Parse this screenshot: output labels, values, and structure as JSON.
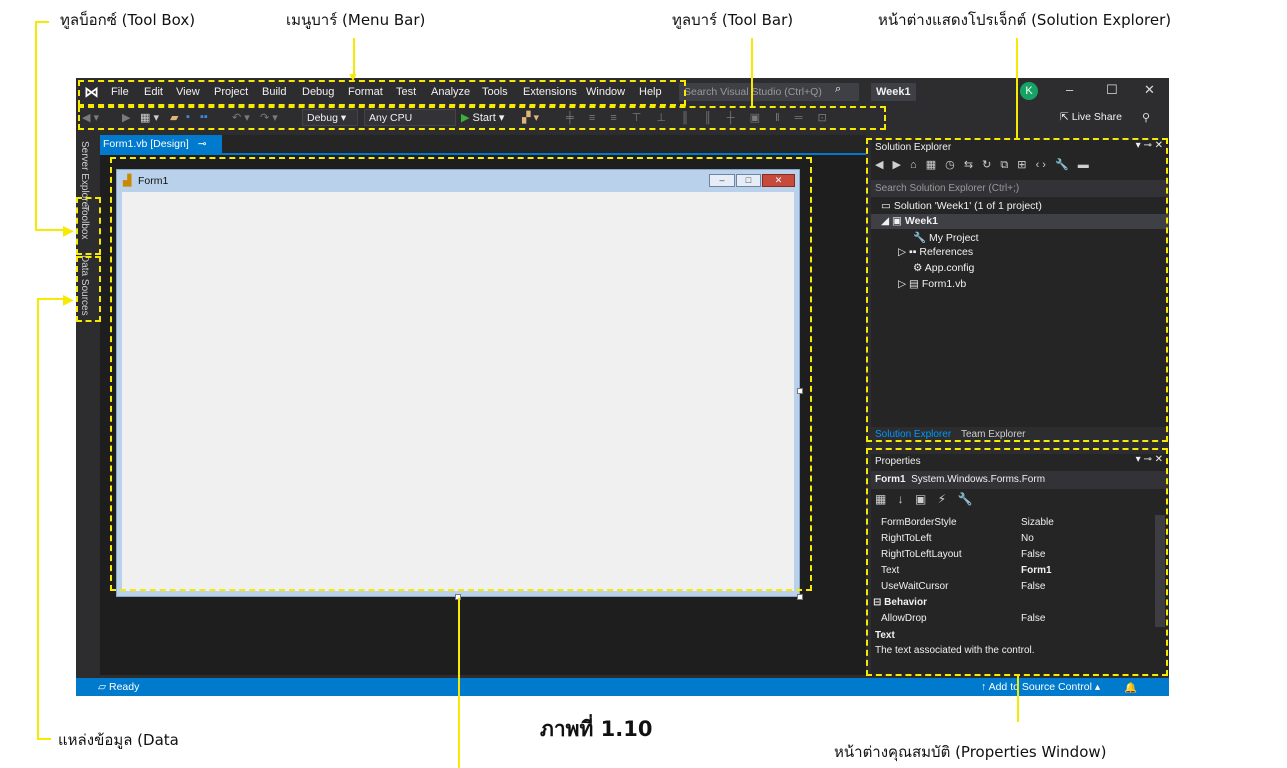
{
  "annotations": {
    "toolbox": "ทูลบ็อกซ์ (Tool Box)",
    "menubar": "เมนูบาร์ (Menu Bar)",
    "toolbar": "ทูลบาร์ (Tool Bar)",
    "solution_explorer": "หน้าต่างแสดงโปรเจ็กต์ (Solution Explorer)",
    "data_sources": "แหล่งข้อมูล (Data",
    "properties_window": "หน้าต่างคุณสมบัติ (Properties Window)",
    "figure_caption": "ภาพที่ 1.10"
  },
  "menu": {
    "items": [
      "File",
      "Edit",
      "View",
      "Project",
      "Build",
      "Debug",
      "Format",
      "Test",
      "Analyze",
      "Tools",
      "Extensions",
      "Window",
      "Help"
    ],
    "search_placeholder": "Search Visual Studio (Ctrl+Q)",
    "project_name": "Week1",
    "avatar": "K"
  },
  "toolbar": {
    "config": "Debug",
    "platform": "Any CPU",
    "start": "Start",
    "live_share": "Live Share"
  },
  "side_tabs": [
    "Server Explorer",
    "Toolbox",
    "Data Sources"
  ],
  "document": {
    "tab_title": "Form1.vb [Design]",
    "form_title": "Form1"
  },
  "solution_explorer": {
    "title": "Solution Explorer",
    "search_placeholder": "Search Solution Explorer (Ctrl+;)",
    "tree": {
      "solution": "Solution 'Week1' (1 of 1 project)",
      "project": "Week1",
      "my_project": "My Project",
      "references": "References",
      "app_config": "App.config",
      "form1": "Form1.vb"
    },
    "tabs": [
      "Solution Explorer",
      "Team Explorer"
    ]
  },
  "properties": {
    "title": "Properties",
    "object_name": "Form1",
    "object_type": "System.Windows.Forms.Form",
    "rows": [
      {
        "name": "FormBorderStyle",
        "value": "Sizable"
      },
      {
        "name": "RightToLeft",
        "value": "No"
      },
      {
        "name": "RightToLeftLayout",
        "value": "False"
      },
      {
        "name": "Text",
        "value": "Form1"
      },
      {
        "name": "UseWaitCursor",
        "value": "False"
      }
    ],
    "category": "Behavior",
    "row_after_category": {
      "name": "AllowDrop",
      "value": "False"
    },
    "desc_title": "Text",
    "desc_text": "The text associated with the control."
  },
  "status": {
    "ready": "Ready",
    "source_control": "Add to Source Control"
  },
  "colors": {
    "accent": "#007acc",
    "annotation": "#f5ea00",
    "ide_background": "#2d2d30"
  }
}
